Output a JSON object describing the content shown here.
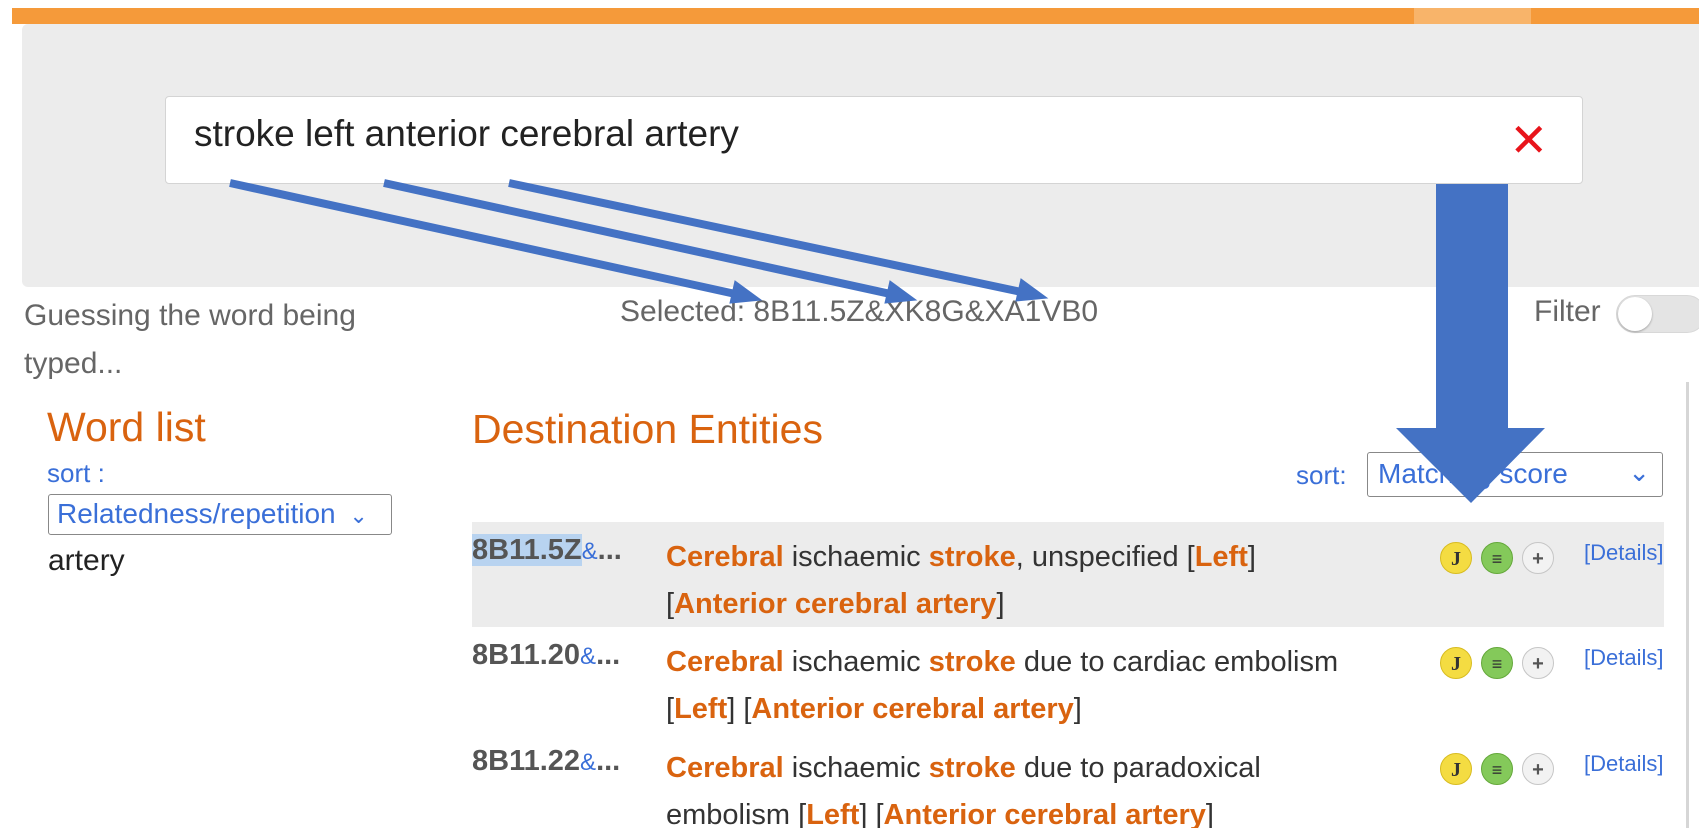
{
  "search": {
    "query": "stroke left anterior cerebral artery",
    "clear_symbol": "✕"
  },
  "status": {
    "guess_text": "Guessing the word being typed...",
    "selected_text": "Selected: 8B11.5Z&XK8G&XA1VB0",
    "filter_label": "Filter",
    "filter_on": false
  },
  "word_list": {
    "title": "Word list",
    "sort_label": "sort :",
    "sort_value": "Relatedness/repetition",
    "items": [
      "artery"
    ]
  },
  "destination": {
    "title": "Destination Entities",
    "sort_label": "sort:",
    "sort_value": "Matching score",
    "rows": [
      {
        "code": "8B11.5Z",
        "amp": "&",
        "ellipsis": "...",
        "selected": true,
        "parts": [
          {
            "t": "Cerebral",
            "b": true
          },
          {
            "t": " ischaemic ",
            "b": false
          },
          {
            "t": "stroke",
            "b": true
          },
          {
            "t": ", unspecified [",
            "b": false
          },
          {
            "t": "Left",
            "b": true
          },
          {
            "t": "] [",
            "b": false
          },
          {
            "t": "Anterior cerebral artery",
            "b": true
          },
          {
            "t": "]",
            "b": false
          }
        ],
        "icons": {
          "j": "J",
          "list": "≡",
          "plus": "+"
        },
        "details": "[Details]"
      },
      {
        "code": "8B11.20",
        "amp": "&",
        "ellipsis": "...",
        "selected": false,
        "parts": [
          {
            "t": "Cerebral",
            "b": true
          },
          {
            "t": " ischaemic ",
            "b": false
          },
          {
            "t": "stroke",
            "b": true
          },
          {
            "t": " due to cardiac embolism [",
            "b": false
          },
          {
            "t": "Left",
            "b": true
          },
          {
            "t": "] [",
            "b": false
          },
          {
            "t": "Anterior cerebral artery",
            "b": true
          },
          {
            "t": "]",
            "b": false
          }
        ],
        "icons": {
          "j": "J",
          "list": "≡",
          "plus": "+"
        },
        "details": "[Details]"
      },
      {
        "code": "8B11.22",
        "amp": "&",
        "ellipsis": "...",
        "selected": false,
        "parts": [
          {
            "t": "Cerebral",
            "b": true
          },
          {
            "t": " ischaemic ",
            "b": false
          },
          {
            "t": "stroke",
            "b": true
          },
          {
            "t": " due to paradoxical embolism [",
            "b": false
          },
          {
            "t": "Left",
            "b": true
          },
          {
            "t": "] [",
            "b": false
          },
          {
            "t": "Anterior cerebral artery",
            "b": true
          },
          {
            "t": "]",
            "b": false
          }
        ],
        "icons": {
          "j": "J",
          "list": "≡",
          "plus": "+"
        },
        "details": "[Details]"
      }
    ]
  },
  "colors": {
    "accent_orange": "#d9630f",
    "link_blue": "#3a6fd8",
    "annotation_arrow": "#4472c4",
    "clear_red": "#e8141b"
  },
  "icon_names": [
    "close-icon",
    "chevron-down-icon",
    "j-icon",
    "list-icon",
    "plus-icon",
    "arrow-annotation"
  ]
}
